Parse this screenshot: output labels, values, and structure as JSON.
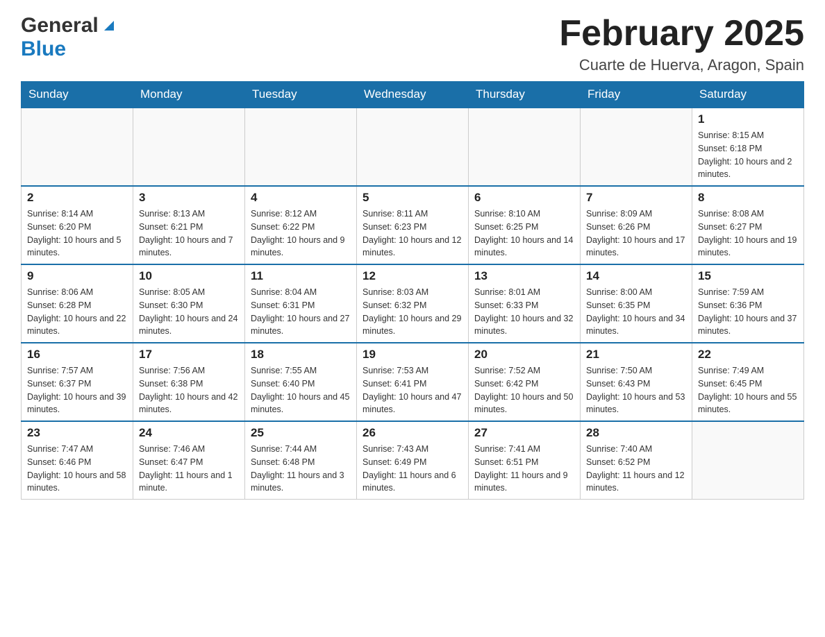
{
  "header": {
    "logo_general": "General",
    "logo_blue": "Blue",
    "month_title": "February 2025",
    "location": "Cuarte de Huerva, Aragon, Spain"
  },
  "days_of_week": [
    "Sunday",
    "Monday",
    "Tuesday",
    "Wednesday",
    "Thursday",
    "Friday",
    "Saturday"
  ],
  "weeks": [
    [
      {
        "day": "",
        "info": ""
      },
      {
        "day": "",
        "info": ""
      },
      {
        "day": "",
        "info": ""
      },
      {
        "day": "",
        "info": ""
      },
      {
        "day": "",
        "info": ""
      },
      {
        "day": "",
        "info": ""
      },
      {
        "day": "1",
        "info": "Sunrise: 8:15 AM\nSunset: 6:18 PM\nDaylight: 10 hours and 2 minutes."
      }
    ],
    [
      {
        "day": "2",
        "info": "Sunrise: 8:14 AM\nSunset: 6:20 PM\nDaylight: 10 hours and 5 minutes."
      },
      {
        "day": "3",
        "info": "Sunrise: 8:13 AM\nSunset: 6:21 PM\nDaylight: 10 hours and 7 minutes."
      },
      {
        "day": "4",
        "info": "Sunrise: 8:12 AM\nSunset: 6:22 PM\nDaylight: 10 hours and 9 minutes."
      },
      {
        "day": "5",
        "info": "Sunrise: 8:11 AM\nSunset: 6:23 PM\nDaylight: 10 hours and 12 minutes."
      },
      {
        "day": "6",
        "info": "Sunrise: 8:10 AM\nSunset: 6:25 PM\nDaylight: 10 hours and 14 minutes."
      },
      {
        "day": "7",
        "info": "Sunrise: 8:09 AM\nSunset: 6:26 PM\nDaylight: 10 hours and 17 minutes."
      },
      {
        "day": "8",
        "info": "Sunrise: 8:08 AM\nSunset: 6:27 PM\nDaylight: 10 hours and 19 minutes."
      }
    ],
    [
      {
        "day": "9",
        "info": "Sunrise: 8:06 AM\nSunset: 6:28 PM\nDaylight: 10 hours and 22 minutes."
      },
      {
        "day": "10",
        "info": "Sunrise: 8:05 AM\nSunset: 6:30 PM\nDaylight: 10 hours and 24 minutes."
      },
      {
        "day": "11",
        "info": "Sunrise: 8:04 AM\nSunset: 6:31 PM\nDaylight: 10 hours and 27 minutes."
      },
      {
        "day": "12",
        "info": "Sunrise: 8:03 AM\nSunset: 6:32 PM\nDaylight: 10 hours and 29 minutes."
      },
      {
        "day": "13",
        "info": "Sunrise: 8:01 AM\nSunset: 6:33 PM\nDaylight: 10 hours and 32 minutes."
      },
      {
        "day": "14",
        "info": "Sunrise: 8:00 AM\nSunset: 6:35 PM\nDaylight: 10 hours and 34 minutes."
      },
      {
        "day": "15",
        "info": "Sunrise: 7:59 AM\nSunset: 6:36 PM\nDaylight: 10 hours and 37 minutes."
      }
    ],
    [
      {
        "day": "16",
        "info": "Sunrise: 7:57 AM\nSunset: 6:37 PM\nDaylight: 10 hours and 39 minutes."
      },
      {
        "day": "17",
        "info": "Sunrise: 7:56 AM\nSunset: 6:38 PM\nDaylight: 10 hours and 42 minutes."
      },
      {
        "day": "18",
        "info": "Sunrise: 7:55 AM\nSunset: 6:40 PM\nDaylight: 10 hours and 45 minutes."
      },
      {
        "day": "19",
        "info": "Sunrise: 7:53 AM\nSunset: 6:41 PM\nDaylight: 10 hours and 47 minutes."
      },
      {
        "day": "20",
        "info": "Sunrise: 7:52 AM\nSunset: 6:42 PM\nDaylight: 10 hours and 50 minutes."
      },
      {
        "day": "21",
        "info": "Sunrise: 7:50 AM\nSunset: 6:43 PM\nDaylight: 10 hours and 53 minutes."
      },
      {
        "day": "22",
        "info": "Sunrise: 7:49 AM\nSunset: 6:45 PM\nDaylight: 10 hours and 55 minutes."
      }
    ],
    [
      {
        "day": "23",
        "info": "Sunrise: 7:47 AM\nSunset: 6:46 PM\nDaylight: 10 hours and 58 minutes."
      },
      {
        "day": "24",
        "info": "Sunrise: 7:46 AM\nSunset: 6:47 PM\nDaylight: 11 hours and 1 minute."
      },
      {
        "day": "25",
        "info": "Sunrise: 7:44 AM\nSunset: 6:48 PM\nDaylight: 11 hours and 3 minutes."
      },
      {
        "day": "26",
        "info": "Sunrise: 7:43 AM\nSunset: 6:49 PM\nDaylight: 11 hours and 6 minutes."
      },
      {
        "day": "27",
        "info": "Sunrise: 7:41 AM\nSunset: 6:51 PM\nDaylight: 11 hours and 9 minutes."
      },
      {
        "day": "28",
        "info": "Sunrise: 7:40 AM\nSunset: 6:52 PM\nDaylight: 11 hours and 12 minutes."
      },
      {
        "day": "",
        "info": ""
      }
    ]
  ]
}
